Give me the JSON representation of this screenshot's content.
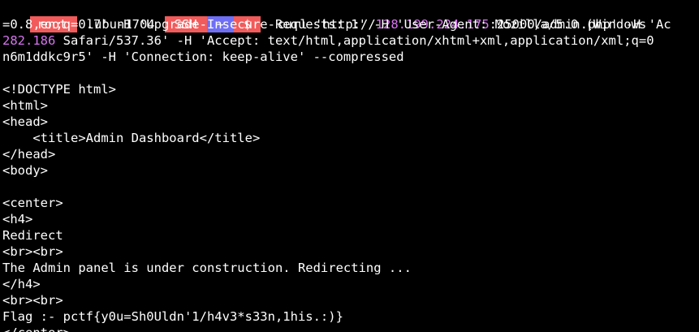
{
  "prompt": {
    "user": "root",
    "host": "lubun1704",
    "ssh": "SSH",
    "dir": "~",
    "symbol": "$"
  },
  "command": {
    "line1_pre": "curl 'http://",
    "line1_ip": "128.199.224.175",
    "line1_post": ":25000/admin.php' -H 'Ac",
    "line2": "=0.8,en;q=0.7' -H 'Upgrade-Insecure-Requests: 1' -H 'User-Agent: Mozilla/5.0 (Windows",
    "line3_num": "282.186",
    "line3_post": " Safari/537.36' -H 'Accept: text/html,application/xhtml+xml,application/xml;q=0",
    "line4": "n6m1ddkc9r5' -H 'Connection: keep-alive' --compressed"
  },
  "output": [
    "<!DOCTYPE html>",
    "<html>",
    "<head>",
    "    <title>Admin Dashboard</title>",
    "</head>",
    "<body>",
    "",
    "<center>",
    "<h4>",
    "Redirect",
    "<br><br>",
    "The Admin panel is under construction. Redirecting ...",
    "</h4>",
    "<br><br>",
    "Flag :- pctf{y0u=Sh0Uldn'1/h4v3*s33n,1his.:)}",
    "</center>"
  ],
  "colors": {
    "background": "#000000",
    "text": "#ffffff",
    "highlight": "#d874f0",
    "segment_red": "#f15b5b",
    "segment_blue": "#6f6ff5"
  }
}
